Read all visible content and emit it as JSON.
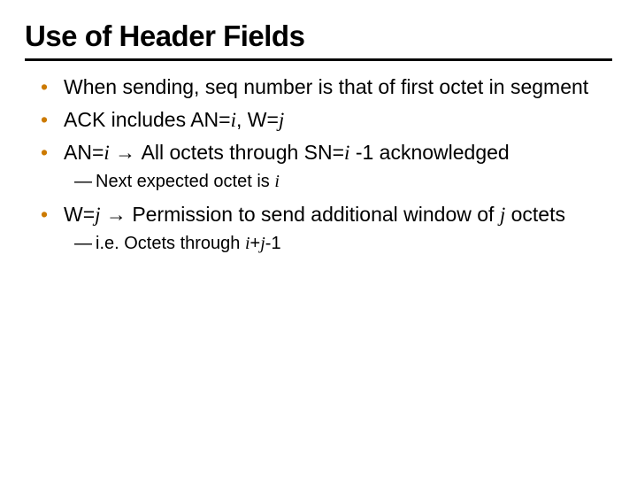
{
  "title": "Use of Header Fields",
  "bullets": {
    "b1": "When sending, seq number is that of first octet in segment",
    "b2_pre": "ACK includes AN=",
    "b2_i": "i",
    "b2_mid": ", W=",
    "b2_j": "j",
    "b3_pre": "AN=",
    "b3_i1": "i",
    "b3_arrow": " → ",
    "b3_mid": "All octets through SN=",
    "b3_i2": "i",
    "b3_post": " -1 acknowledged",
    "b3_sub_pre": "Next expected octet is ",
    "b3_sub_i": "i",
    "b4_pre": "W=",
    "b4_j": "j",
    "b4_arrow": " → ",
    "b4_mid": "Permission to send additional window of ",
    "b4_j2": "j",
    "b4_post": " octets",
    "b4_sub_pre": "i.e. Octets through ",
    "b4_sub_i": "i",
    "b4_sub_plus": "+",
    "b4_sub_j": "j",
    "b4_sub_post": "-1"
  }
}
